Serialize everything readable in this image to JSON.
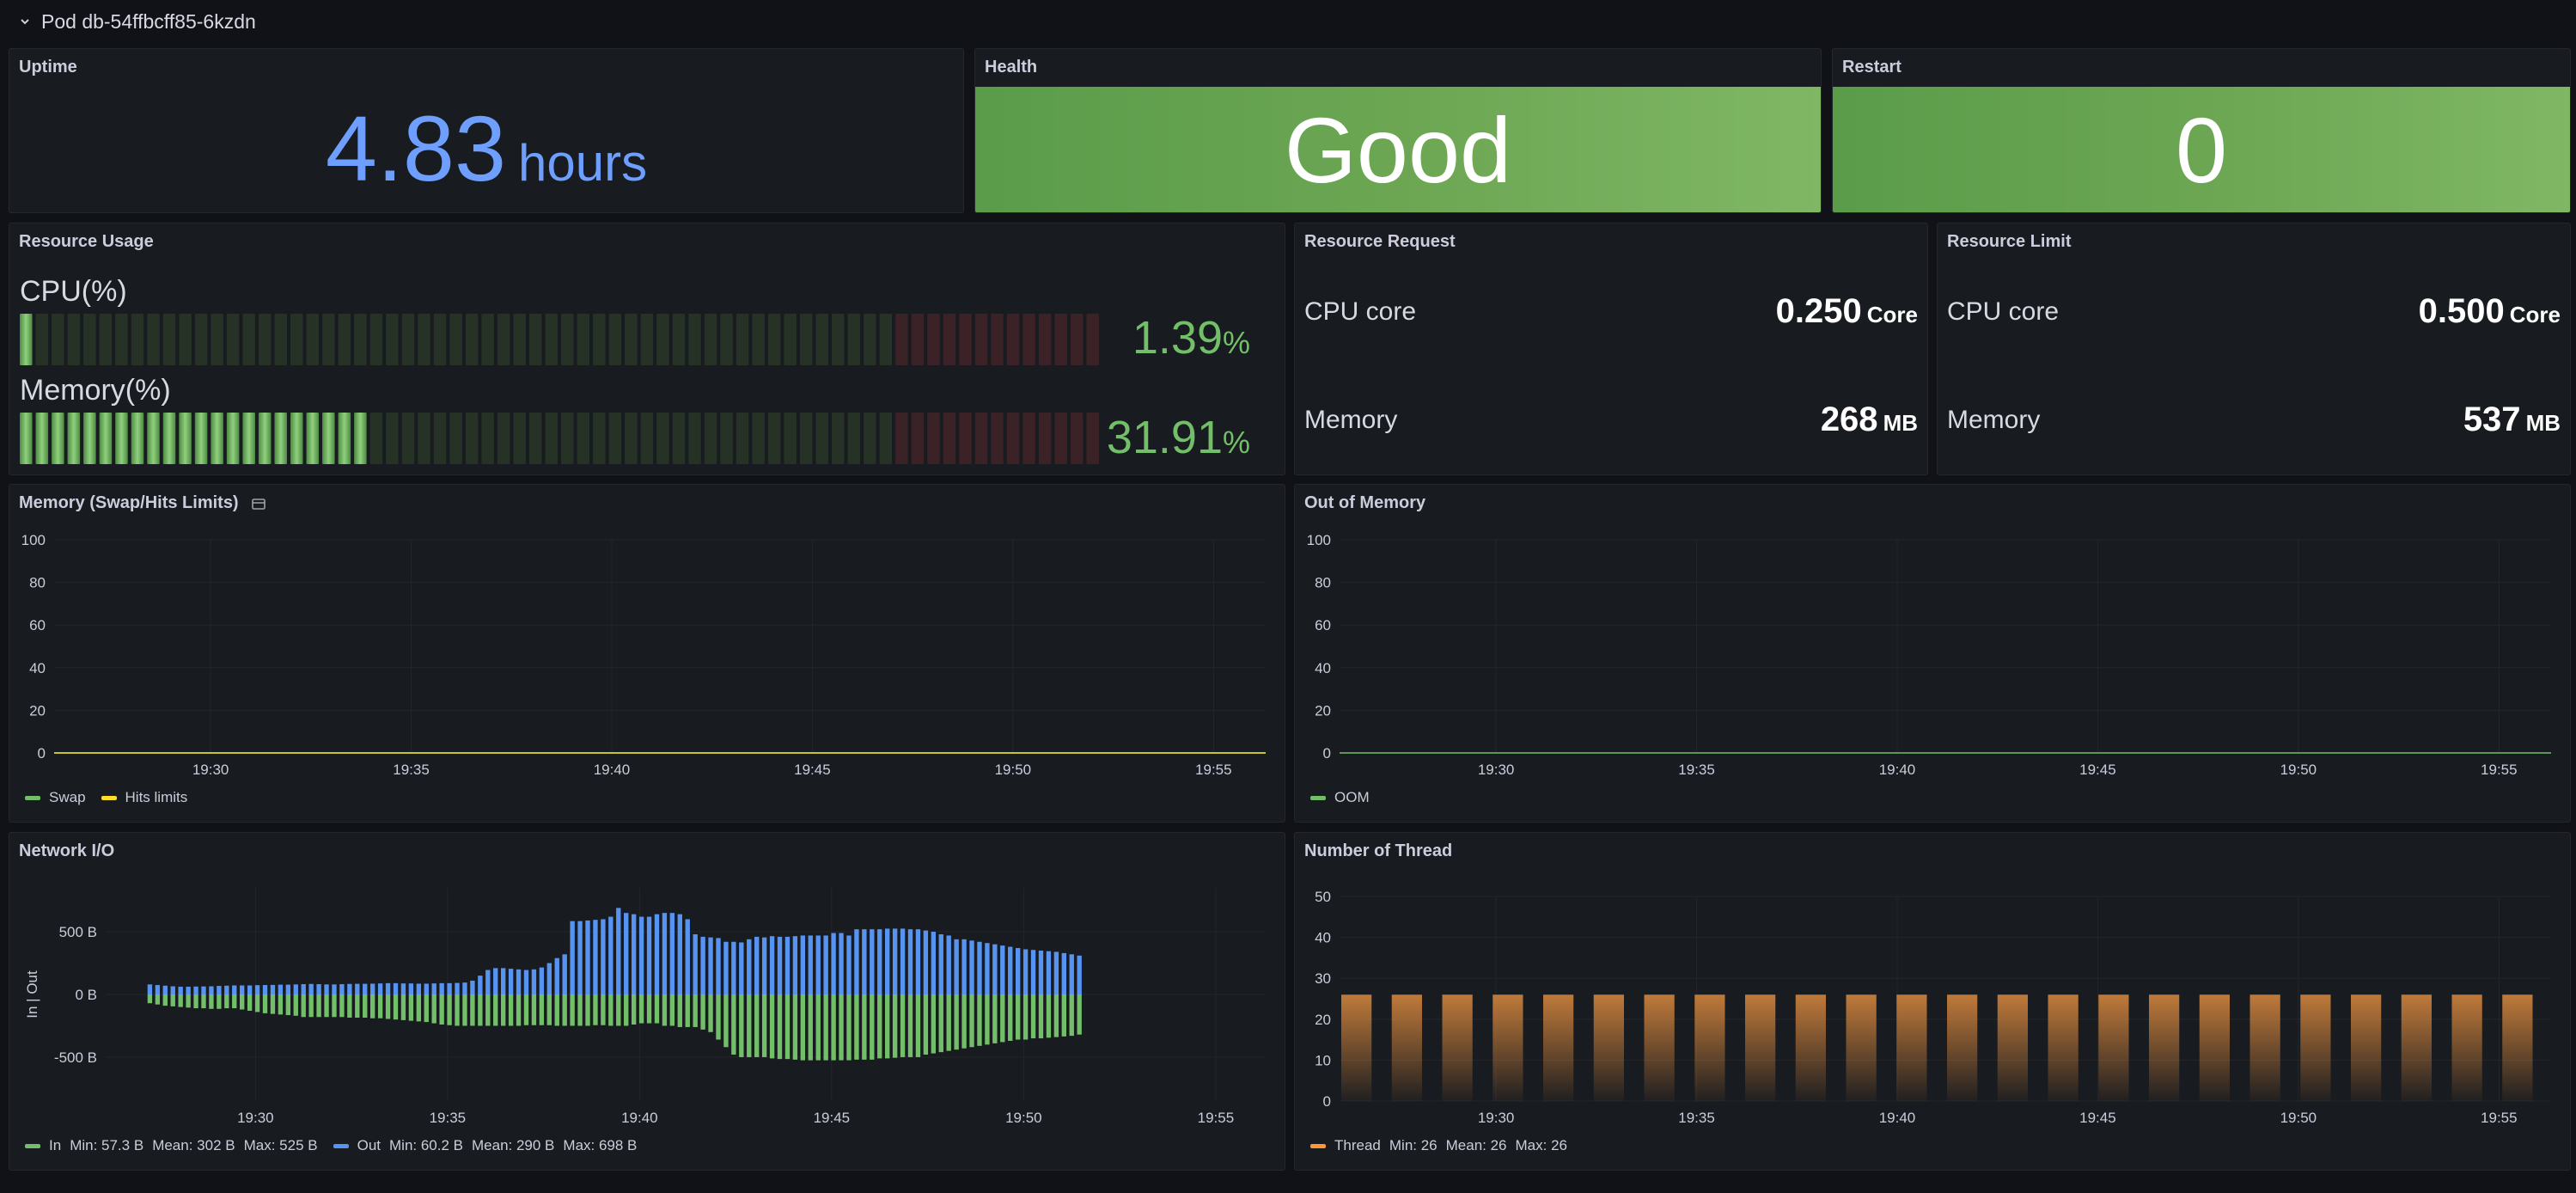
{
  "row": {
    "title": "Pod db-54ffbcff85-6kzdn"
  },
  "uptime": {
    "title": "Uptime",
    "value": "4.83",
    "unit": "hours",
    "color": "#6e9fff"
  },
  "health": {
    "title": "Health",
    "value": "Good"
  },
  "restart": {
    "title": "Restart",
    "value": "0"
  },
  "resource_usage": {
    "title": "Resource Usage",
    "cpu": {
      "label": "CPU(%)",
      "value": "1.39",
      "unit": "%",
      "fraction": 0.0139
    },
    "memory": {
      "label": "Memory(%)",
      "value": "31.91",
      "unit": "%",
      "fraction": 0.3191
    },
    "threshold_fraction": 0.81,
    "colors": {
      "ok": "#73bf69",
      "warn": "#f2495c"
    }
  },
  "resource_request": {
    "title": "Resource Request",
    "rows": [
      {
        "name": "CPU core",
        "value": "0.250",
        "unit": "Core"
      },
      {
        "name": "Memory",
        "value": "268",
        "unit": "MB"
      }
    ]
  },
  "resource_limit": {
    "title": "Resource Limit",
    "rows": [
      {
        "name": "CPU core",
        "value": "0.500",
        "unit": "Core"
      },
      {
        "name": "Memory",
        "value": "537",
        "unit": "MB"
      }
    ]
  },
  "memory_swap": {
    "title": "Memory (Swap/Hits Limits)",
    "legend": [
      {
        "name": "Swap",
        "color": "#73bf69"
      },
      {
        "name": "Hits limits",
        "color": "#fade2a"
      }
    ]
  },
  "oom": {
    "title": "Out of Memory",
    "legend": [
      {
        "name": "OOM",
        "color": "#73bf69"
      }
    ]
  },
  "network": {
    "title": "Network I/O",
    "legend": [
      {
        "name": "In",
        "color": "#73bf69",
        "min": "Min: 57.3 B",
        "mean": "Mean: 302 B",
        "max": "Max: 525 B"
      },
      {
        "name": "Out",
        "color": "#5794f2",
        "min": "Min: 60.2 B",
        "mean": "Mean: 290 B",
        "max": "Max: 698 B"
      }
    ]
  },
  "threads": {
    "title": "Number of Thread",
    "legend": [
      {
        "name": "Thread",
        "color": "#ff9830",
        "min": "Min: 26",
        "mean": "Mean: 26",
        "max": "Max: 26"
      }
    ]
  },
  "chart_data": [
    {
      "type": "line",
      "title": "Memory (Swap/Hits Limits)",
      "x_ticks": [
        "19:30",
        "19:35",
        "19:40",
        "19:45",
        "19:50",
        "19:55"
      ],
      "y_ticks": [
        "0",
        "20",
        "40",
        "60",
        "80",
        "100"
      ],
      "ylim": [
        0,
        100
      ],
      "xlim_min": [
        26.1,
        56.3
      ],
      "series": [
        {
          "name": "Swap",
          "color": "#73bf69",
          "values": [
            0,
            0
          ]
        },
        {
          "name": "Hits limits",
          "color": "#fade2a",
          "values": [
            0,
            0
          ]
        }
      ]
    },
    {
      "type": "line",
      "title": "Out of Memory",
      "x_ticks": [
        "19:30",
        "19:35",
        "19:40",
        "19:45",
        "19:50",
        "19:55"
      ],
      "y_ticks": [
        "0",
        "20",
        "40",
        "60",
        "80",
        "100"
      ],
      "ylim": [
        0,
        100
      ],
      "xlim_min": [
        26.1,
        56.3
      ],
      "series": [
        {
          "name": "OOM",
          "color": "#73bf69",
          "values": [
            0,
            0
          ]
        }
      ]
    },
    {
      "type": "bar",
      "title": "Network I/O",
      "ylabel": "In | Out",
      "x_ticks": [
        "19:30",
        "19:35",
        "19:40",
        "19:45",
        "19:50",
        "19:55"
      ],
      "y_ticks": [
        "500 B",
        "0 B",
        "-500 B"
      ],
      "ylim": [
        -850,
        850
      ],
      "x_start_min": 27.25,
      "x_step_min": 0.2,
      "series": [
        {
          "name": "Out",
          "color": "#5794f2",
          "values": [
            80,
            75,
            70,
            65,
            62,
            62,
            63,
            64,
            65,
            68,
            70,
            72,
            72,
            72,
            74,
            75,
            76,
            78,
            78,
            80,
            82,
            84,
            82,
            80,
            80,
            82,
            84,
            85,
            85,
            86,
            88,
            90,
            90,
            88,
            88,
            86,
            86,
            88,
            90,
            90,
            92,
            95,
            110,
            150,
            195,
            210,
            210,
            205,
            200,
            195,
            200,
            215,
            250,
            290,
            320,
            585,
            585,
            590,
            595,
            600,
            620,
            690,
            650,
            640,
            620,
            620,
            640,
            650,
            650,
            640,
            600,
            480,
            460,
            455,
            450,
            420,
            420,
            415,
            440,
            460,
            455,
            465,
            460,
            460,
            465,
            470,
            470,
            470,
            470,
            490,
            490,
            470,
            520,
            520,
            520,
            520,
            525,
            525,
            525,
            520,
            520,
            510,
            500,
            480,
            470,
            440,
            440,
            430,
            420,
            410,
            400,
            390,
            380,
            370,
            360,
            355,
            350,
            345,
            340,
            330,
            320,
            310
          ]
        },
        {
          "name": "In",
          "color": "#73bf69",
          "values": [
            -70,
            -80,
            -90,
            -95,
            -100,
            -105,
            -110,
            -110,
            -115,
            -115,
            -110,
            -110,
            -120,
            -130,
            -140,
            -150,
            -155,
            -160,
            -165,
            -170,
            -180,
            -180,
            -180,
            -180,
            -180,
            -180,
            -185,
            -185,
            -185,
            -190,
            -190,
            -195,
            -200,
            -205,
            -210,
            -215,
            -220,
            -230,
            -240,
            -245,
            -250,
            -250,
            -250,
            -250,
            -250,
            -250,
            -250,
            -250,
            -250,
            -245,
            -245,
            -245,
            -245,
            -250,
            -250,
            -250,
            -250,
            -250,
            -245,
            -245,
            -250,
            -250,
            -250,
            -240,
            -230,
            -230,
            -230,
            -250,
            -250,
            -260,
            -260,
            -260,
            -280,
            -300,
            -360,
            -420,
            -480,
            -500,
            -500,
            -500,
            -500,
            -510,
            -515,
            -515,
            -520,
            -525,
            -525,
            -525,
            -525,
            -525,
            -525,
            -525,
            -520,
            -520,
            -520,
            -510,
            -510,
            -505,
            -500,
            -500,
            -500,
            -480,
            -470,
            -460,
            -450,
            -440,
            -430,
            -420,
            -410,
            -400,
            -390,
            -380,
            -370,
            -360,
            -360,
            -350,
            -350,
            -345,
            -340,
            -335,
            -330,
            -320
          ]
        }
      ]
    },
    {
      "type": "bar",
      "title": "Number of Thread",
      "x_ticks": [
        "19:30",
        "19:35",
        "19:40",
        "19:45",
        "19:50",
        "19:55"
      ],
      "y_ticks": [
        "0",
        "10",
        "20",
        "30",
        "40",
        "50"
      ],
      "ylim": [
        0,
        50
      ],
      "series": [
        {
          "name": "Thread",
          "color": "#ff9830",
          "values": [
            26,
            26,
            26,
            26,
            26,
            26,
            26,
            26,
            26,
            26,
            26,
            26,
            26,
            26,
            26,
            26,
            26,
            26,
            26,
            26,
            26,
            26,
            26,
            26
          ]
        }
      ]
    }
  ]
}
